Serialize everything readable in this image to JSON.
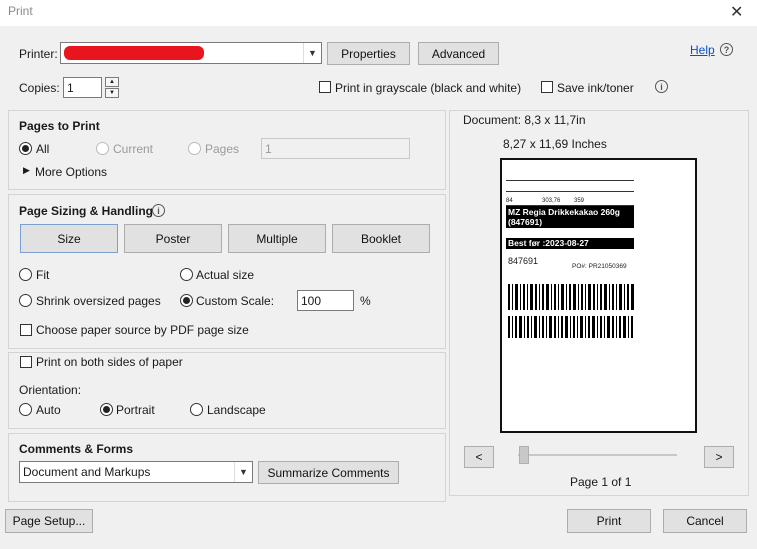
{
  "window": {
    "title": "Print"
  },
  "printer": {
    "label": "Printer:",
    "properties_label": "Properties",
    "advanced_label": "Advanced",
    "help_label": "Help"
  },
  "copies": {
    "label": "Copies:",
    "value": "1",
    "grayscale_label": "Print in grayscale (black and white)",
    "save_ink_label": "Save ink/toner"
  },
  "pages_to_print": {
    "title": "Pages to Print",
    "all_label": "All",
    "current_label": "Current",
    "pages_label": "Pages",
    "pages_value": "1",
    "more_options_label": "More Options"
  },
  "sizing": {
    "title": "Page Sizing & Handling",
    "tabs": [
      "Size",
      "Poster",
      "Multiple",
      "Booklet"
    ],
    "fit_label": "Fit",
    "actual_label": "Actual size",
    "shrink_label": "Shrink oversized pages",
    "custom_label": "Custom Scale:",
    "custom_value": "100",
    "percent_label": "%",
    "paper_source_label": "Choose paper source by PDF page size"
  },
  "duplex": {
    "both_sides_label": "Print on both sides of paper",
    "orientation_label": "Orientation:",
    "auto_label": "Auto",
    "portrait_label": "Portrait",
    "landscape_label": "Landscape"
  },
  "comments": {
    "title": "Comments & Forms",
    "selected": "Document and Markups",
    "summarize_label": "Summarize Comments"
  },
  "preview": {
    "document_size": "Document: 8,3 x 11,7in",
    "paper_size": "8,27 x 11,69 Inches",
    "page_indicator": "Page 1 of 1",
    "prev_label": "<",
    "next_label": ">"
  },
  "label_sheet": {
    "product": "MZ Regia Drikkekakao 260g (847691)",
    "best_before": "Best før :2023-08-27",
    "article_no": "847691",
    "po": "PO#:  PR21050369",
    "qty1": "84",
    "qty2": "303,76",
    "qty3": "359"
  },
  "footer": {
    "page_setup_label": "Page Setup...",
    "print_label": "Print",
    "cancel_label": "Cancel"
  }
}
